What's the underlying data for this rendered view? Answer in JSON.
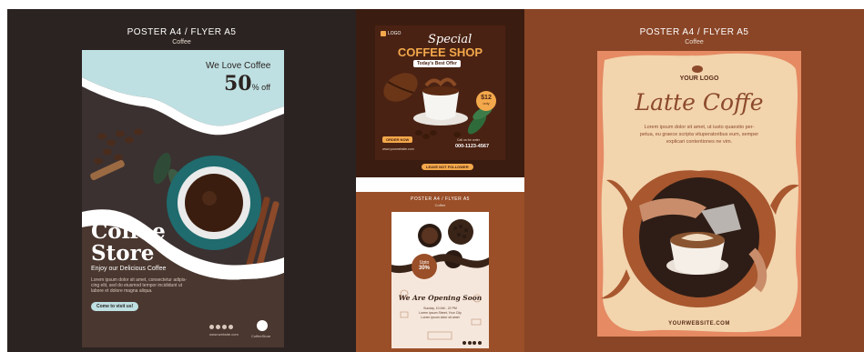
{
  "panel_left": {
    "caption_title": "POSTER A4 / FLYER A5",
    "caption_sub": "Coffee",
    "tagline": "We Love Coffee",
    "discount_number": "50",
    "discount_suffix": "% off",
    "title_line1": "Coffee",
    "title_line2": "Store",
    "subtitle": "Enjoy our Delicious Coffee",
    "body_line1": "Lorem ipsum dolor sit amet, consectetur adipis-",
    "body_line2": "cing elit, sed do eiusmod tempor incididunt ut",
    "body_line3": "labore et dolore magna aliqua.",
    "cta": "Come to visit us!",
    "footer_url": "www.website.com",
    "brand": "CoffeeStore"
  },
  "panel_mid_top": {
    "logo": "LOGO",
    "title_script": "Special",
    "title_main": "COFFEE SHOP",
    "offer": "Today's Best Offer",
    "price": "$12",
    "price_sub": "only",
    "order_btn": "ORDER NOW",
    "website": "www.yourwebsite.com",
    "phone_label": "Call us for order",
    "phone": "000-1123-4567",
    "cta_bottom": "LEAVE NOT FOLLOWER"
  },
  "panel_mid_bottom": {
    "caption_title": "POSTER A4 / FLYER A5",
    "caption_sub": "Coffee",
    "badge_line1": "Upto",
    "badge_line2": "30%",
    "headline": "We Are Opening Soon",
    "info_line1": "Sunday, 10 AM - 22 PM",
    "info_line2": "Lorem ipsum Street, Your City",
    "info_line3": "Lorem ipsum dolor sit amet"
  },
  "panel_right": {
    "caption_title": "POSTER A4 / FLYER A5",
    "caption_sub": "Coffee",
    "logo": "YOUR LOGO",
    "title": "Latte Coffe",
    "body_line1": "Lorem ipsum dolor sit amet, ut iusto quaestio per-",
    "body_line2": "petua, eu graece scripta vituperatoribus eum, semper",
    "body_line3": "explicari contentiones ne vim.",
    "website": "YOURWEBSITE.COM"
  },
  "colors": {
    "left_bg": "#2b2321",
    "right_bg": "#8a4526",
    "mid_bottom_bg": "#9a4f28",
    "poster_cream": "#f2d4ad",
    "latte_title": "#8c4a2b",
    "mint": "#bfe0e2"
  }
}
